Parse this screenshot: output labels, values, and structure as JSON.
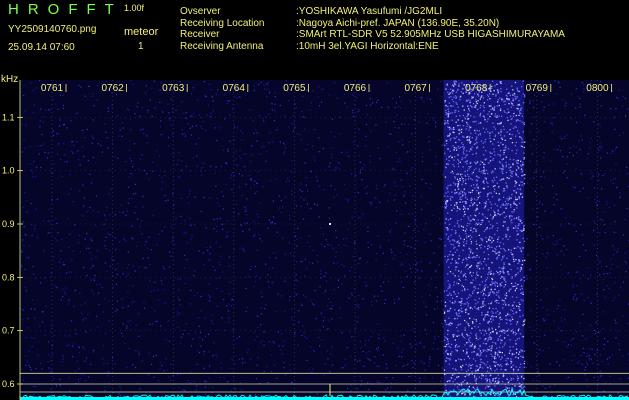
{
  "header": {
    "app_title": "HROFFT",
    "version": "1.00f",
    "filename": "YY2509140760.png",
    "datetime": "25.09.14 07:60",
    "meteor_label": "meteor",
    "meteor_count": "1",
    "info": [
      {
        "key": "Ovserver",
        "value": ":YOSHIKAWA Yasufumi /JG2MLI"
      },
      {
        "key": "Receiving Location",
        "value": ":Nagoya Aichi-pref. JAPAN (136.90E, 35.20N)"
      },
      {
        "key": "Receiver",
        "value": ":SMArt RTL-SDR V5 52.905MHz USB HIGASHIMURAYAMA"
      },
      {
        "key": "Receiving Antenna",
        "value": ":10mH 3el.YAGI Horizontal:ENE"
      }
    ]
  },
  "colors": {
    "background": "#000000",
    "noise": "#1a1aa0",
    "bright_band": "#6b6bff",
    "trace": "#00ffff",
    "label": "#f2ef7a",
    "title": "#7cff4a"
  },
  "chart_data": {
    "type": "heatmap",
    "title": "",
    "ylabel": "kHz",
    "x_ticks": [
      "0761",
      "0762",
      "0763",
      "0764",
      "0765",
      "0766",
      "0767",
      "0768",
      "0769",
      "0800"
    ],
    "y_ticks": [
      "1.1",
      "1.0",
      "0.9",
      "0.8",
      "0.7",
      "0.6"
    ],
    "y_range": [
      0.57,
      1.17
    ],
    "bright_band_x": [
      "0767",
      "0768"
    ],
    "reference_lines_khz": [
      0.62,
      0.6,
      0.585
    ],
    "meteor_echo": {
      "x": "0766",
      "y_khz": 0.9
    }
  }
}
